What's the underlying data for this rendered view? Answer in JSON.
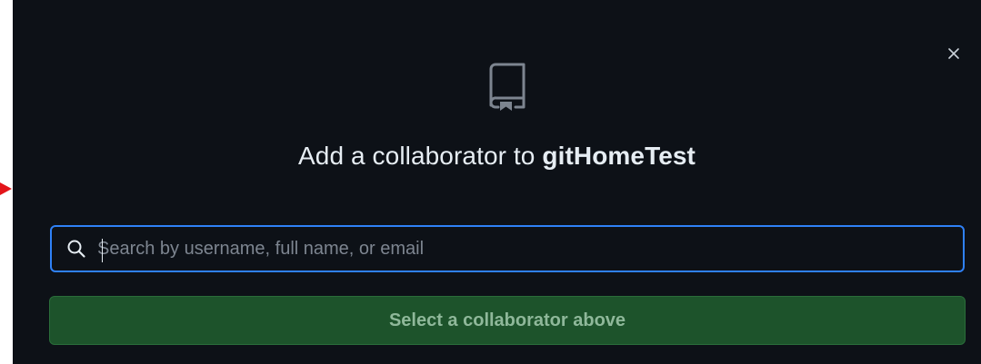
{
  "dialog": {
    "title_prefix": "Add a collaborator to ",
    "repo_name": "gitHomeTest",
    "close_glyph": "×",
    "repo_icon": "repo-icon",
    "search": {
      "icon": "search-icon",
      "value": "",
      "placeholder": "Search by username, full name, or email"
    },
    "submit_label": "Select a collaborator above"
  },
  "colors": {
    "background": "#0d1117",
    "text": "#e6edf3",
    "focus_border": "#2f81f7",
    "button_bg": "#1d532b",
    "button_text": "#8fb89a",
    "pointer_arrow": "#e3151a"
  }
}
